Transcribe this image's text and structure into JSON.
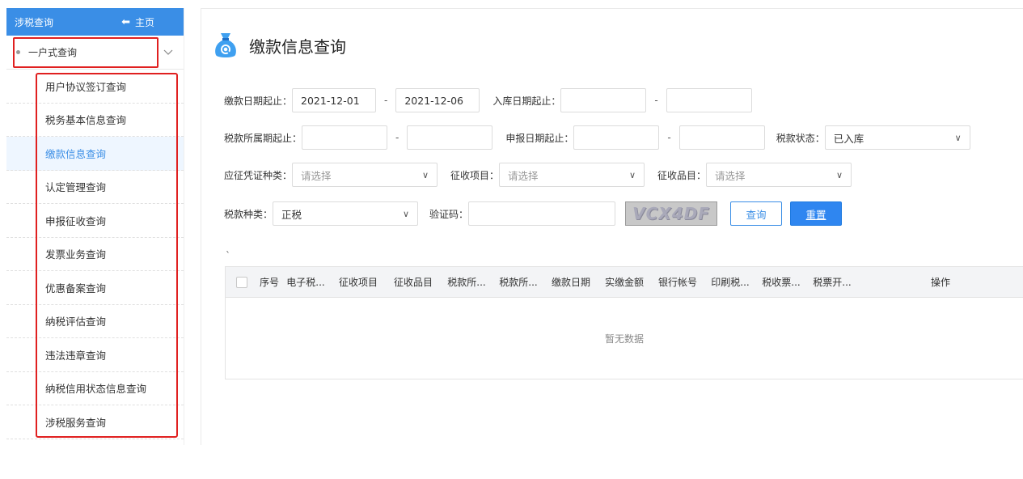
{
  "sidebar": {
    "header_title": "涉税查询",
    "home_label": "主页",
    "group_label": "一户式查询",
    "items": [
      {
        "label": "用户协议签订查询"
      },
      {
        "label": "税务基本信息查询"
      },
      {
        "label": "缴款信息查询"
      },
      {
        "label": "认定管理查询"
      },
      {
        "label": "申报征收查询"
      },
      {
        "label": "发票业务查询"
      },
      {
        "label": "优惠备案查询"
      },
      {
        "label": "纳税评估查询"
      },
      {
        "label": "违法违章查询"
      },
      {
        "label": "纳税信用状态信息查询"
      },
      {
        "label": "涉税服务查询"
      }
    ],
    "active_index": 2
  },
  "page": {
    "title": "缴款信息查询"
  },
  "form": {
    "pay_date_label": "缴款日期起止：",
    "pay_date_start": "2021-12-01",
    "pay_date_end": "2021-12-06",
    "storage_date_label": "入库日期起止：",
    "storage_date_start": "",
    "storage_date_end": "",
    "tax_period_label": "税款所属期起止：",
    "declare_date_label": "申报日期起止：",
    "tax_status_label": "税款状态：",
    "tax_status_value": "已入库",
    "voucher_type_label": "应征凭证种类：",
    "voucher_type_placeholder": "请选择",
    "levy_item_label": "征收项目：",
    "levy_item_placeholder": "请选择",
    "levy_product_label": "征收品目：",
    "levy_product_placeholder": "请选择",
    "tax_kind_label": "税款种类：",
    "tax_kind_value": "正税",
    "captcha_label": "验证码：",
    "captcha_text": "VCX4DF",
    "query_button": "查询",
    "reset_button": "重置",
    "dash": "-"
  },
  "stray_mark": "`",
  "table": {
    "columns": [
      "序号",
      "电子税...",
      "征收项目",
      "征收品目",
      "税款所...",
      "税款所...",
      "缴款日期",
      "实缴金额",
      "银行帐号",
      "印刷税...",
      "税收票...",
      "税票开...",
      "操作"
    ],
    "empty_text": "暂无数据"
  },
  "colors": {
    "accent": "#3a8ee6",
    "highlight_box": "#e02020"
  }
}
